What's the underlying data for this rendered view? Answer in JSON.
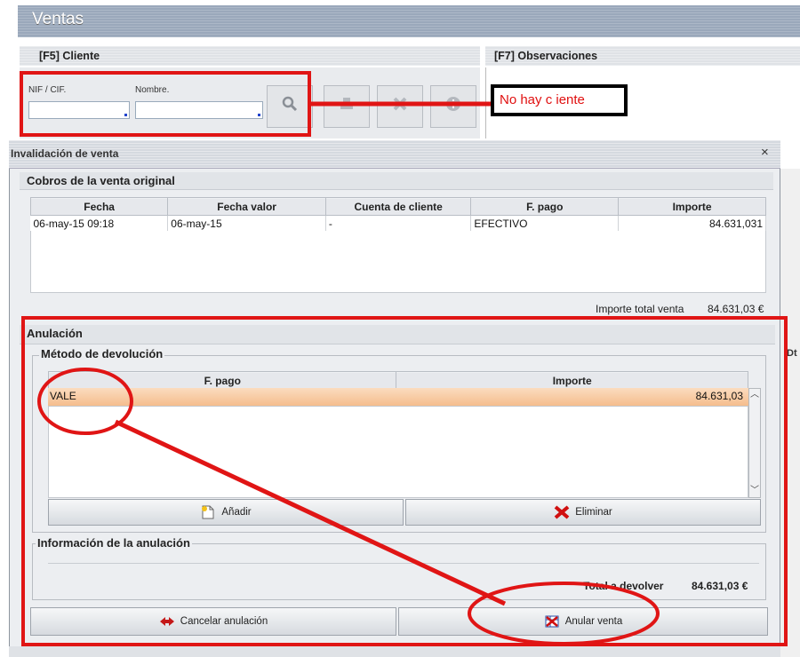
{
  "window": {
    "title": "Ventas",
    "sections": {
      "cliente": "[F5] Cliente",
      "observaciones": "[F7] Observaciones"
    },
    "fields": {
      "nif_label": "NIF / CIF.",
      "nombre_label": "Nombre."
    },
    "no_client_note": "No hay c iente"
  },
  "dialog": {
    "title": "Invalidación de venta",
    "close_glyph": "×",
    "cobros": {
      "heading": "Cobros de la venta original",
      "columns": [
        "Fecha",
        "Fecha valor",
        "Cuenta de cliente",
        "F. pago",
        "Importe"
      ],
      "rows": [
        {
          "fecha": "06-may-15 09:18",
          "fecha_valor": "06-may-15",
          "cuenta": "-",
          "f_pago": "EFECTIVO",
          "importe": "84.631,031"
        }
      ],
      "total_label": "Importe total venta",
      "total_value": "84.631,03 €"
    },
    "anulacion": {
      "heading": "Anulación",
      "metodo": {
        "legend": "Método de devolución",
        "columns": [
          "F. pago",
          "Importe"
        ],
        "rows": [
          {
            "f_pago": "VALE",
            "importe": "84.631,03"
          }
        ],
        "add_label": "Añadir",
        "delete_label": "Eliminar"
      },
      "info": {
        "legend": "Información de la anulación",
        "total_label": "Total a devolver",
        "total_value": "84.631,03 €"
      }
    },
    "actions": {
      "cancel_label": "Cancelar anulación",
      "void_label": "Anular venta"
    },
    "right_fragment": "Dt"
  },
  "colors": {
    "annotation_red": "#e01515",
    "selected_row": "#f8c89e"
  },
  "icons": [
    "search-icon",
    "stamp-icon",
    "clear-icon",
    "info-icon",
    "add-icon",
    "delete-icon",
    "cancel-icon",
    "void-icon"
  ]
}
